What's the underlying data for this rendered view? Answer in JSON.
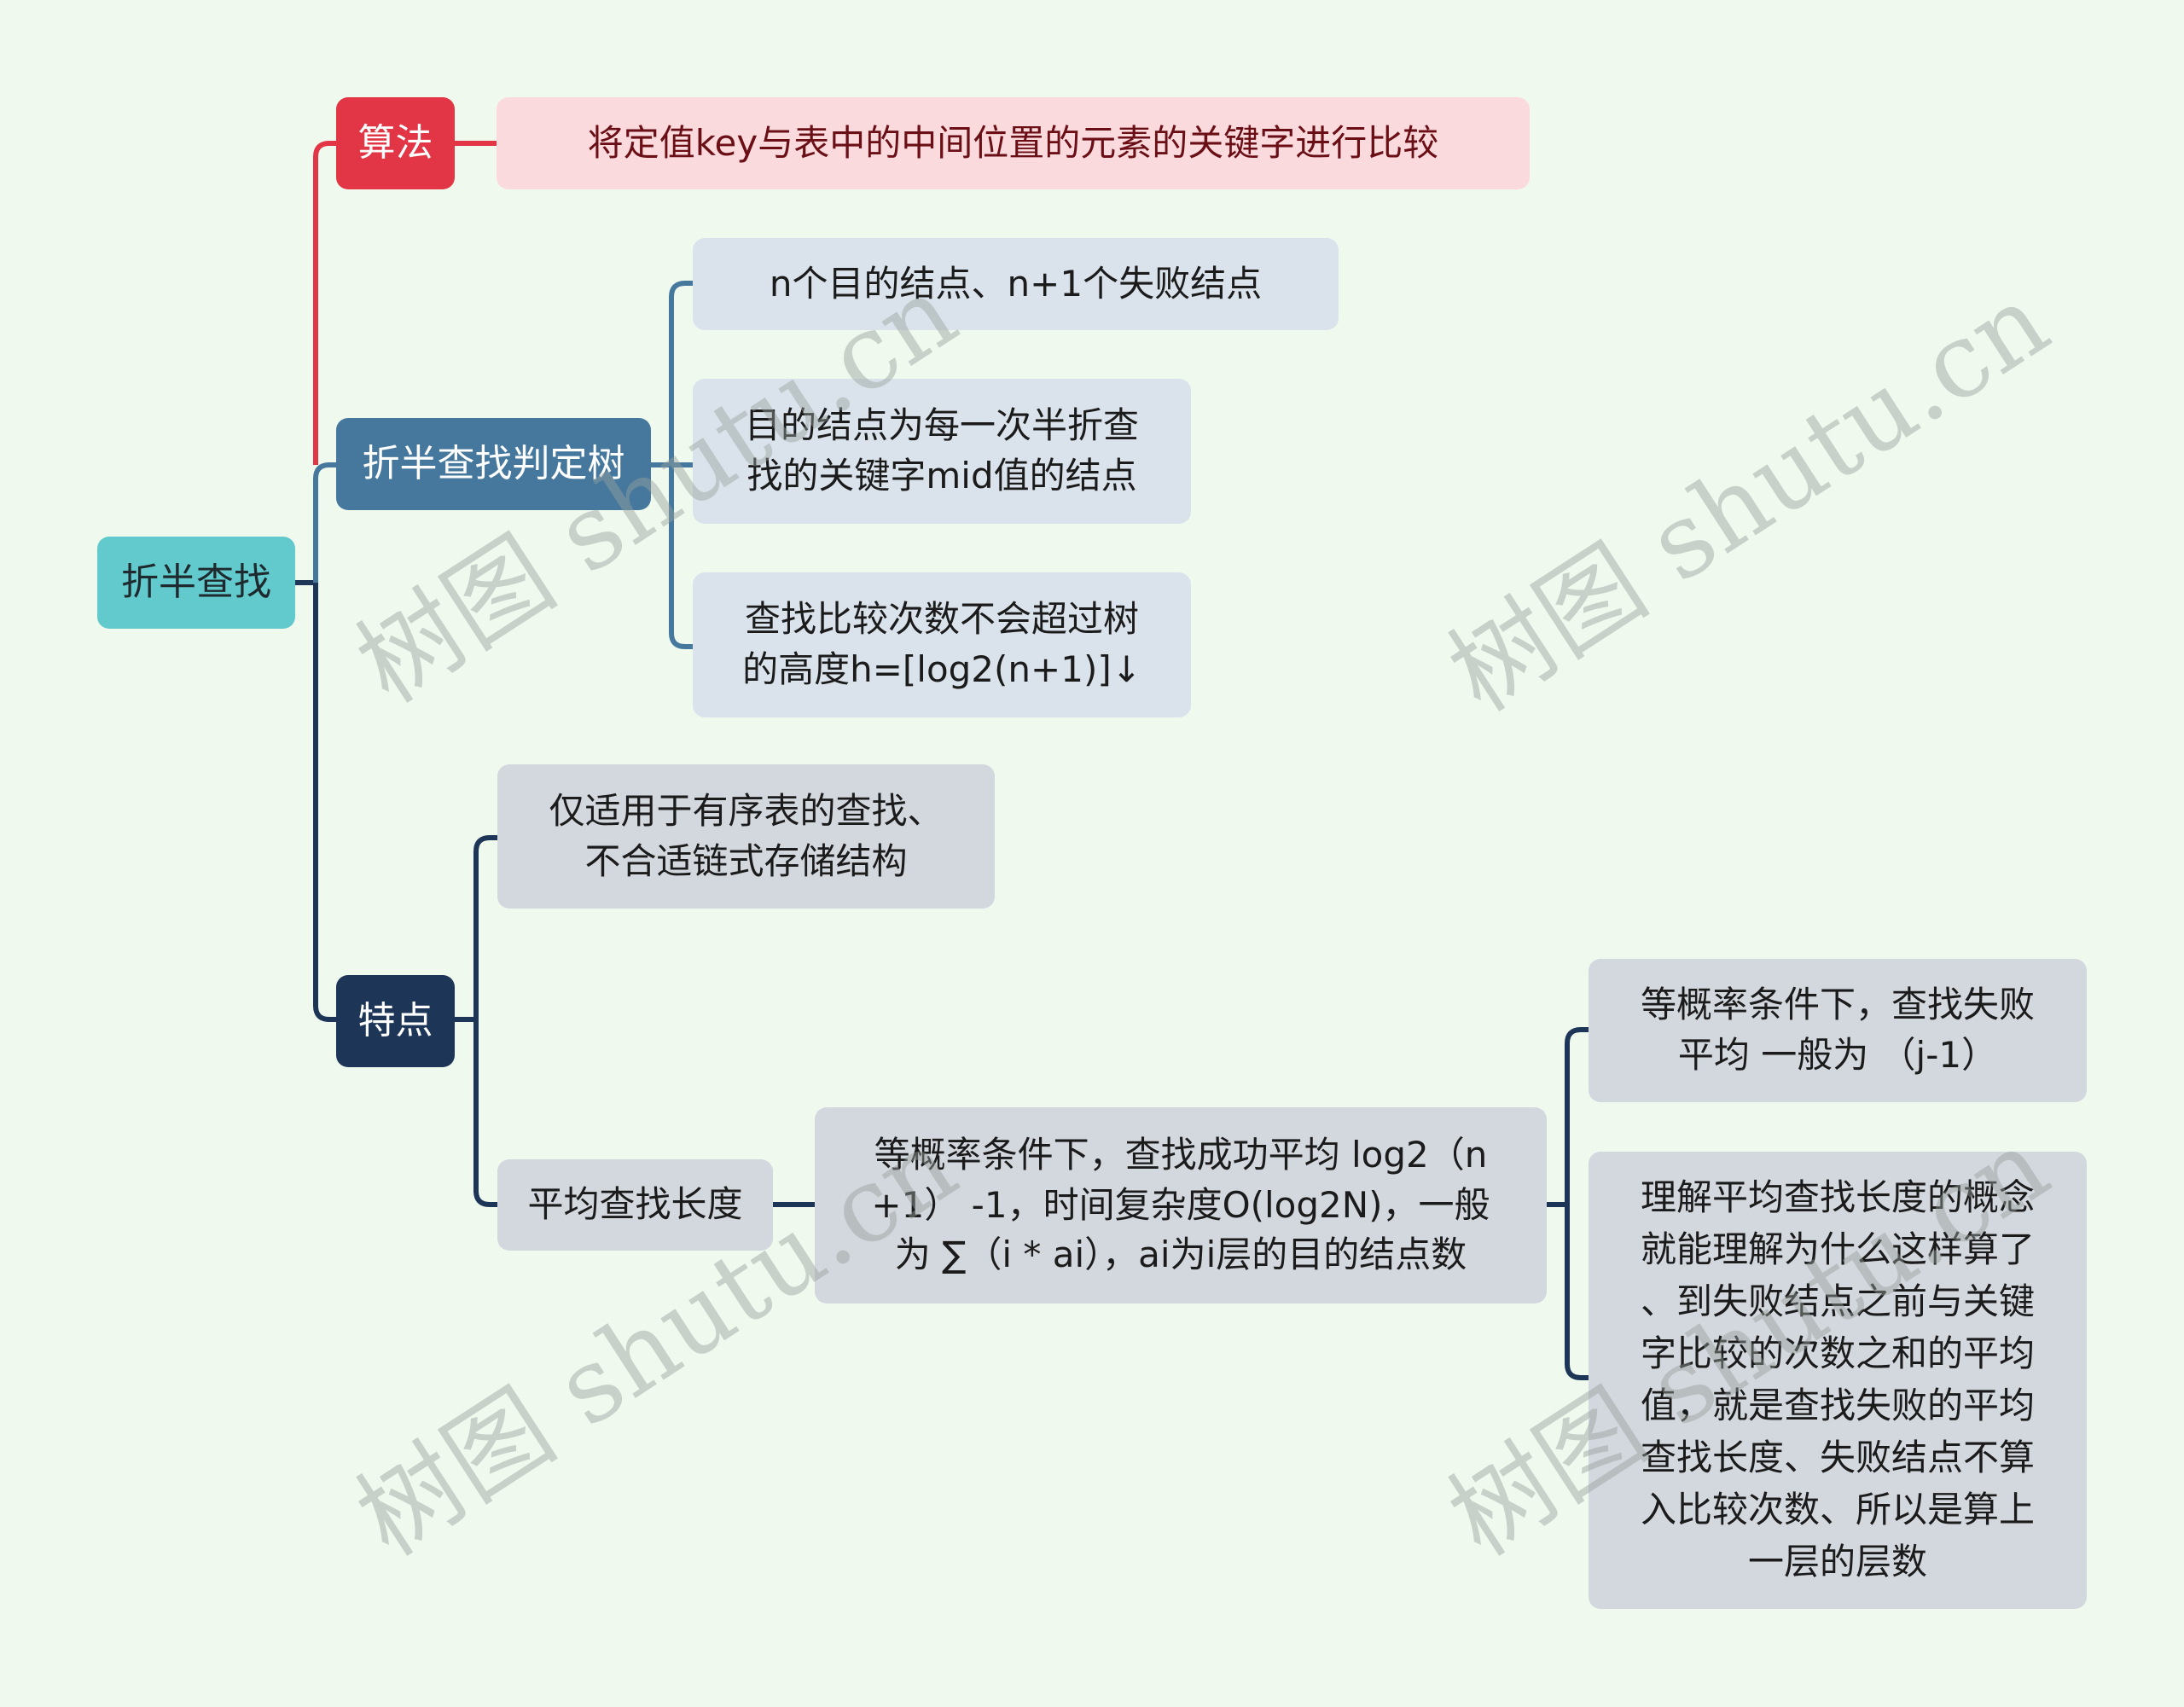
{
  "colors": {
    "background": "#F0F9EE",
    "root": "#62C9CC",
    "algorithm_branch": "#E23545",
    "decision_tree_branch": "#46789E",
    "features_branch": "#1D3557"
  },
  "mindmap": {
    "root": "折半查找",
    "branches": [
      {
        "label": "算法",
        "children": [
          "将定值key与表中的中间位置的元素的关键字进行比较"
        ]
      },
      {
        "label": "折半查找判定树",
        "children": [
          "n个目的结点、n+1个失败结点",
          "目的结点为每一次半折查\n找的关键字mid值的结点",
          "查找比较次数不会超过树\n的高度h=[log2(n+1)]↓"
        ]
      },
      {
        "label": "特点",
        "children": [
          "仅适用于有序表的查找、\n不合适链式存储结构",
          {
            "label": "平均查找长度",
            "detail": "等概率条件下，查找成功平均  log2（n\n+1） -1，时间复杂度O(log2N)，一般\n为 ∑（i * ai），ai为i层的目的结点数",
            "children": [
              "等概率条件下，查找失败\n平均  一般为  （j-1）",
              "理解平均查找长度的概念\n就能理解为什么这样算了\n、到失败结点之前与关键\n字比较的次数之和的平均\n值，就是查找失败的平均\n查找长度、失败结点不算\n入比较次数、所以是算上\n一层的层数"
            ]
          }
        ]
      }
    ]
  },
  "watermark": "树图 shutu.cn"
}
